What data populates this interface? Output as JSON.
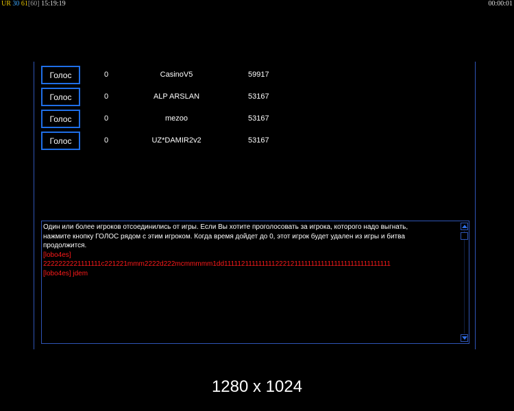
{
  "status_bar": {
    "ur_label": "UR",
    "count": "30",
    "fps": "61",
    "fps_max": "[60]",
    "clock": "15:19:19",
    "elapsed": "00:00:01"
  },
  "vote_panel": {
    "players": [
      {
        "button_label": "Голос",
        "votes": "0",
        "name": "CasinoV5",
        "id": "59917"
      },
      {
        "button_label": "Голос",
        "votes": "0",
        "name": "ALP ARSLAN",
        "id": "53167"
      },
      {
        "button_label": "Голос",
        "votes": "0",
        "name": "mezoo",
        "id": "53167"
      },
      {
        "button_label": "Голос",
        "votes": "0",
        "name": "UZ*DAMIR2v2",
        "id": "53167"
      }
    ]
  },
  "message_log": {
    "lines": [
      {
        "type": "system",
        "text": "Один или более игроков отсоединились от игры. Если Вы хотите проголосовать за игрока, которого надо выгнать,"
      },
      {
        "type": "system",
        "text": " нажмите кнопку ГОЛОС рядом с этим игроком. Когда время дойдет до 0, этот игрок будет удален из игры и битва"
      },
      {
        "type": "system",
        "text": " продолжится."
      },
      {
        "type": "chat",
        "text": "[lobo4es]"
      },
      {
        "type": "chat",
        "text": " 2222222221111111c221221mmm2222d222mcmmmmm1dd1111121111111112221211111111111111111111111111111"
      },
      {
        "type": "chat",
        "text": "[lobo4es] jdem"
      }
    ]
  },
  "resolution_caption": "1280 x 1024",
  "colors": {
    "accent": "#1f6fe8",
    "frame": "#2f55b8",
    "chat_text": "#ff1a1a",
    "background": "#000000"
  },
  "icons": {
    "scroll_up": "triangle-up-icon",
    "scroll_down": "triangle-down-icon"
  }
}
